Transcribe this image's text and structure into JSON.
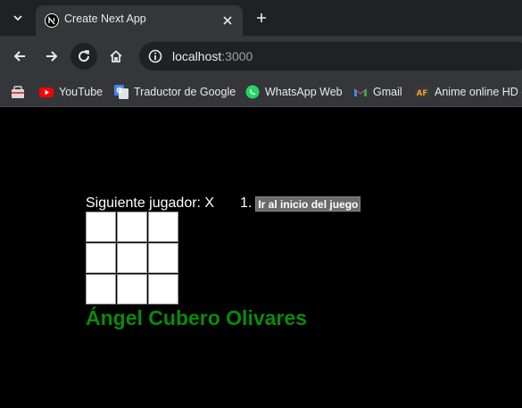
{
  "browser": {
    "tab": {
      "title": "Create Next App"
    },
    "omnibox": {
      "host": "localhost",
      "port": ":3000"
    },
    "icons": {
      "tab_search": "chevron-down-icon",
      "favicon": "nextjs-icon",
      "close": "close-icon",
      "new_tab": "plus-icon",
      "back": "arrow-left-icon",
      "forward": "arrow-right-icon",
      "reload": "reload-icon",
      "home": "home-icon",
      "site_info": "site-info-icon"
    },
    "bookmarks": [
      {
        "label": "YouTube",
        "icon": "youtube-icon"
      },
      {
        "label": "Traductor de Google",
        "icon": "google-translate-icon"
      },
      {
        "label": "WhatsApp Web",
        "icon": "whatsapp-icon"
      },
      {
        "label": "Gmail",
        "icon": "gmail-icon"
      },
      {
        "label": "Anime online HD -",
        "icon": "animeflv-icon"
      }
    ],
    "colors": {
      "tabstrip": "#202124",
      "toolbar": "#35363a",
      "text": "#e8eaed"
    }
  },
  "game": {
    "status": "Siguiente jugador: X",
    "board": {
      "squares": [
        "",
        "",
        "",
        "",
        "",
        "",
        "",
        "",
        ""
      ]
    },
    "moves": [
      {
        "number": "1.",
        "label": "Ir al inicio del juego"
      }
    ],
    "author": "Ángel Cubero Olivares",
    "colors": {
      "author": "#0a8a0a",
      "background": "#000000"
    }
  }
}
